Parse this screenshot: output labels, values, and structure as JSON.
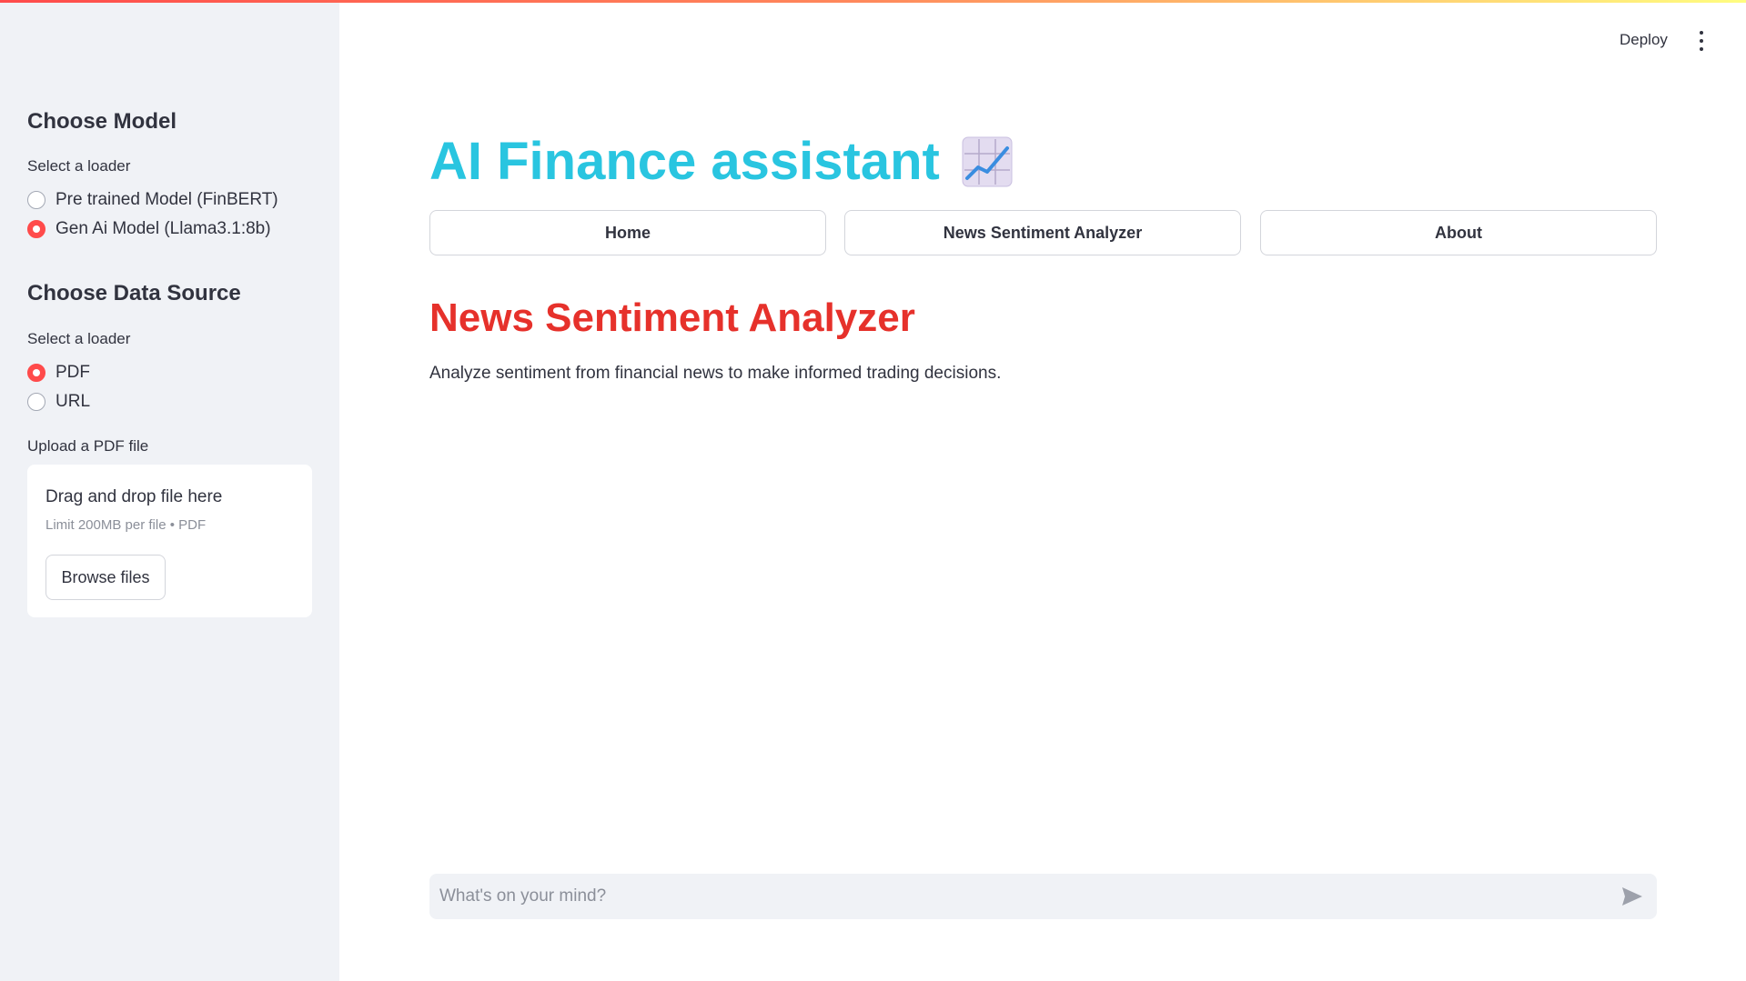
{
  "header": {
    "deploy_label": "Deploy",
    "menu_icon": "more-vertical-icon"
  },
  "sidebar": {
    "model_section": {
      "heading": "Choose Model",
      "loader_label": "Select a loader",
      "options": [
        {
          "label": "Pre trained Model (FinBERT)",
          "selected": false
        },
        {
          "label": "Gen Ai Model (Llama3.1:8b)",
          "selected": true
        }
      ]
    },
    "data_source_section": {
      "heading": "Choose Data Source",
      "loader_label": "Select a loader",
      "options": [
        {
          "label": "PDF",
          "selected": true
        },
        {
          "label": "URL",
          "selected": false
        }
      ]
    },
    "upload": {
      "label": "Upload a PDF file",
      "dropzone_title": "Drag and drop file here",
      "dropzone_limit": "Limit 200MB per file • PDF",
      "browse_label": "Browse files"
    }
  },
  "main": {
    "title": "AI Finance assistant",
    "title_icon": "chart-increasing-icon",
    "nav": [
      {
        "label": "Home"
      },
      {
        "label": "News Sentiment Analyzer"
      },
      {
        "label": "About"
      }
    ],
    "page_heading": "News Sentiment Analyzer",
    "page_description": "Analyze sentiment from financial news to make informed trading decisions."
  },
  "chat": {
    "placeholder": "What's on your mind?",
    "send_icon": "send-icon"
  },
  "colors": {
    "accent": "#ff4b4b",
    "title": "#29c5e0",
    "heading": "#e6312b",
    "sidebar_bg": "#f0f2f6"
  }
}
